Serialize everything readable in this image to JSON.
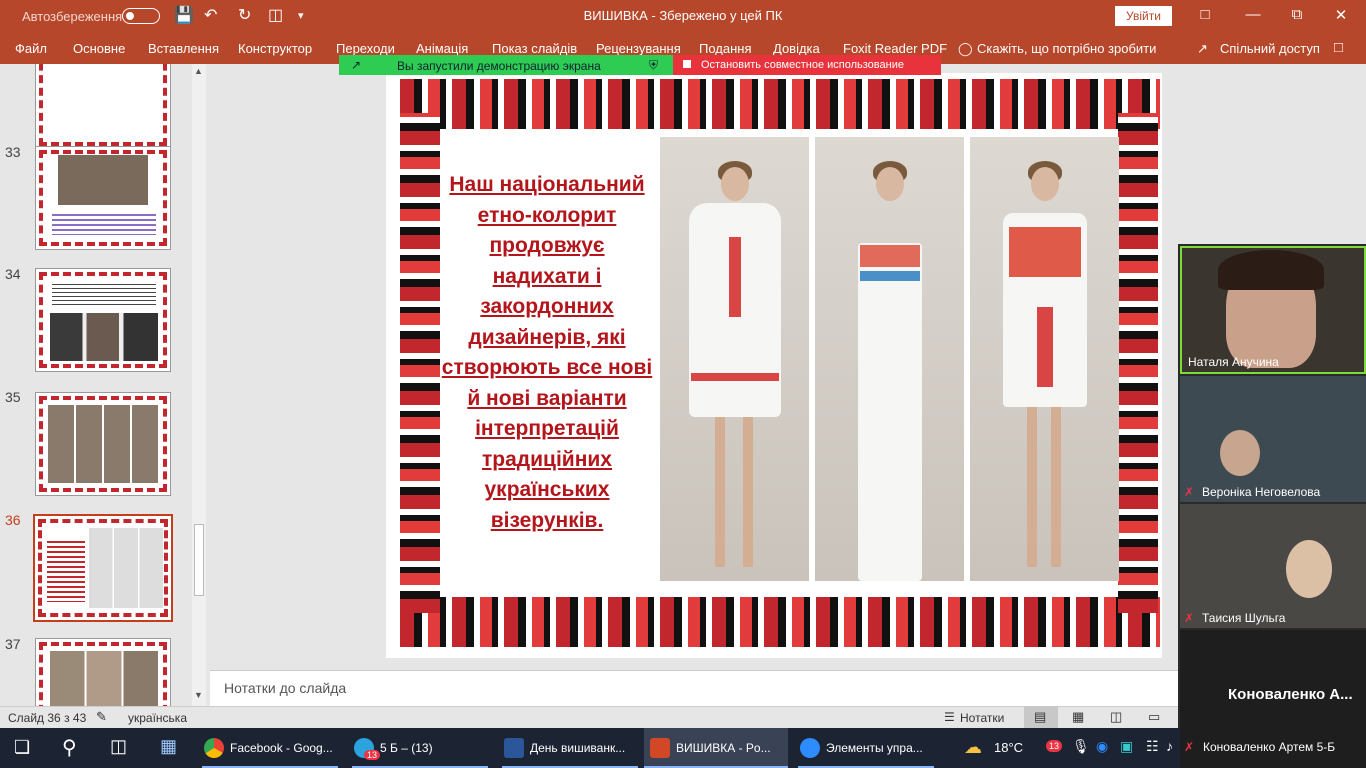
{
  "titlebar": {
    "autosave": "Автозбереження",
    "title": "ВИШИВКА  -  Збережено у цей ПК",
    "signin": "Увійти"
  },
  "ribbon": {
    "tabs": [
      "Файл",
      "Основне",
      "Вставлення",
      "Конструктор",
      "Переходи",
      "Анімація",
      "Показ слайдів",
      "Рецензування",
      "Подання",
      "Довідка",
      "Foxit Reader PDF"
    ],
    "tell_me": "Скажіть, що потрібно зробити",
    "share": "Спільний доступ"
  },
  "share_banner": {
    "status": "Вы запустили демонстрацию экрана",
    "stop": "Остановить совместное использование",
    "status_color": "#2ecc52",
    "stop_color": "#e8333c"
  },
  "slides_panel": {
    "numbers": [
      "33",
      "34",
      "35",
      "36",
      "37"
    ],
    "active": "36"
  },
  "slide": {
    "text": "Наш національний етно-колорит продовжує надихати і закордонних дизайнерів, які створюють все нові й нові варіанти інтерпретацій традиційних українських візерунків.",
    "text_color": "#b3151b"
  },
  "notes": {
    "placeholder": "Нотатки до слайда"
  },
  "status": {
    "slide": "Слайд 36 з 43",
    "language": "українська",
    "notes_btn": "Нотатки"
  },
  "video": {
    "participants": [
      "Наталя Анучина",
      "Вероніка Неговелова",
      "Таисия Шульга",
      "Коноваленко  А...",
      "Коноваленко Артем 5-Б"
    ]
  },
  "taskbar": {
    "apps": [
      "Facebook - Goog...",
      "5 Б – (13)",
      "День вишиванк...",
      "ВИШИВКА - Po...",
      "Элементы упра..."
    ],
    "weather": "18°C",
    "telegram_badge": "13",
    "tray_badge": "13"
  },
  "colors": {
    "accent": "#b7472a",
    "taskbar": "#1c2434"
  }
}
